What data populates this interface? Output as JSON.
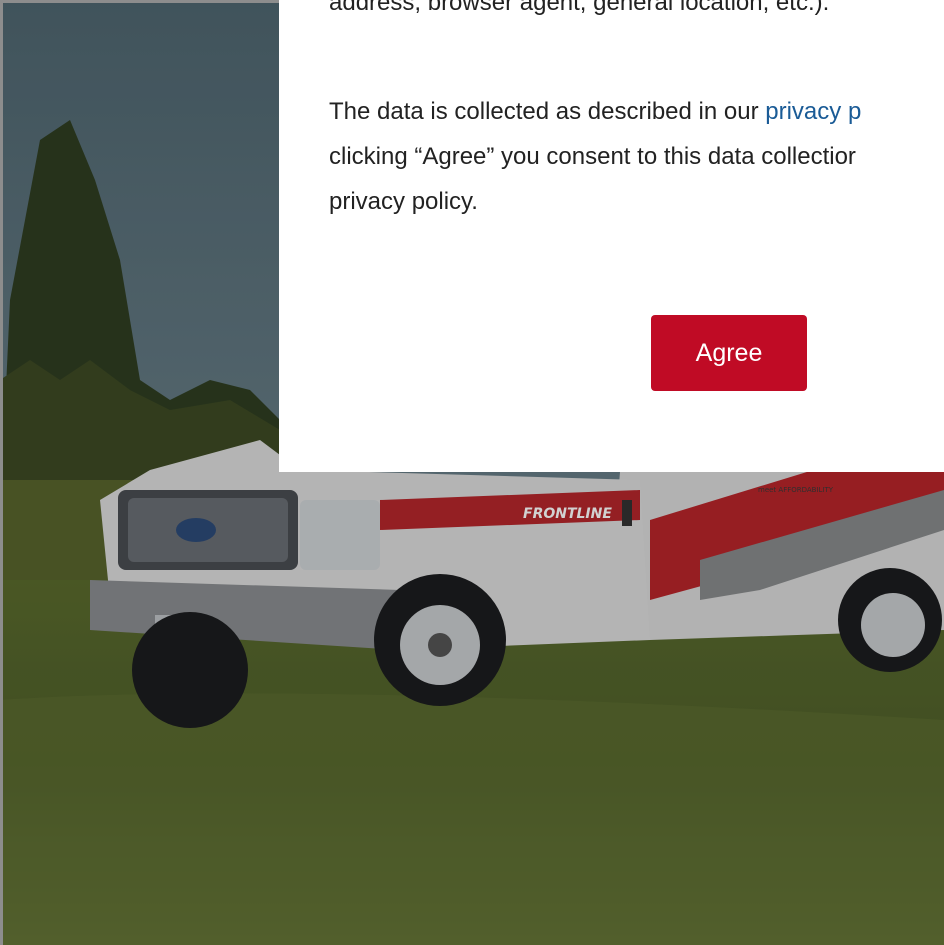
{
  "consent": {
    "paragraph_1_tail": "address, browser agent, general location, etc.).",
    "paragraph_2_before_link": "The data is collected as described in our ",
    "privacy_link": "privacy p",
    "paragraph_2_after_link": "clicking “Agree” you consent to this data collectior",
    "paragraph_2_last_line": "privacy policy.",
    "agree_label": "Agree"
  },
  "background": {
    "vehicle_text": "FRONTLINE",
    "side_text": "meet AFFORDABILITY"
  },
  "colors": {
    "accent": "#c00b25",
    "link": "#1a5b96"
  }
}
